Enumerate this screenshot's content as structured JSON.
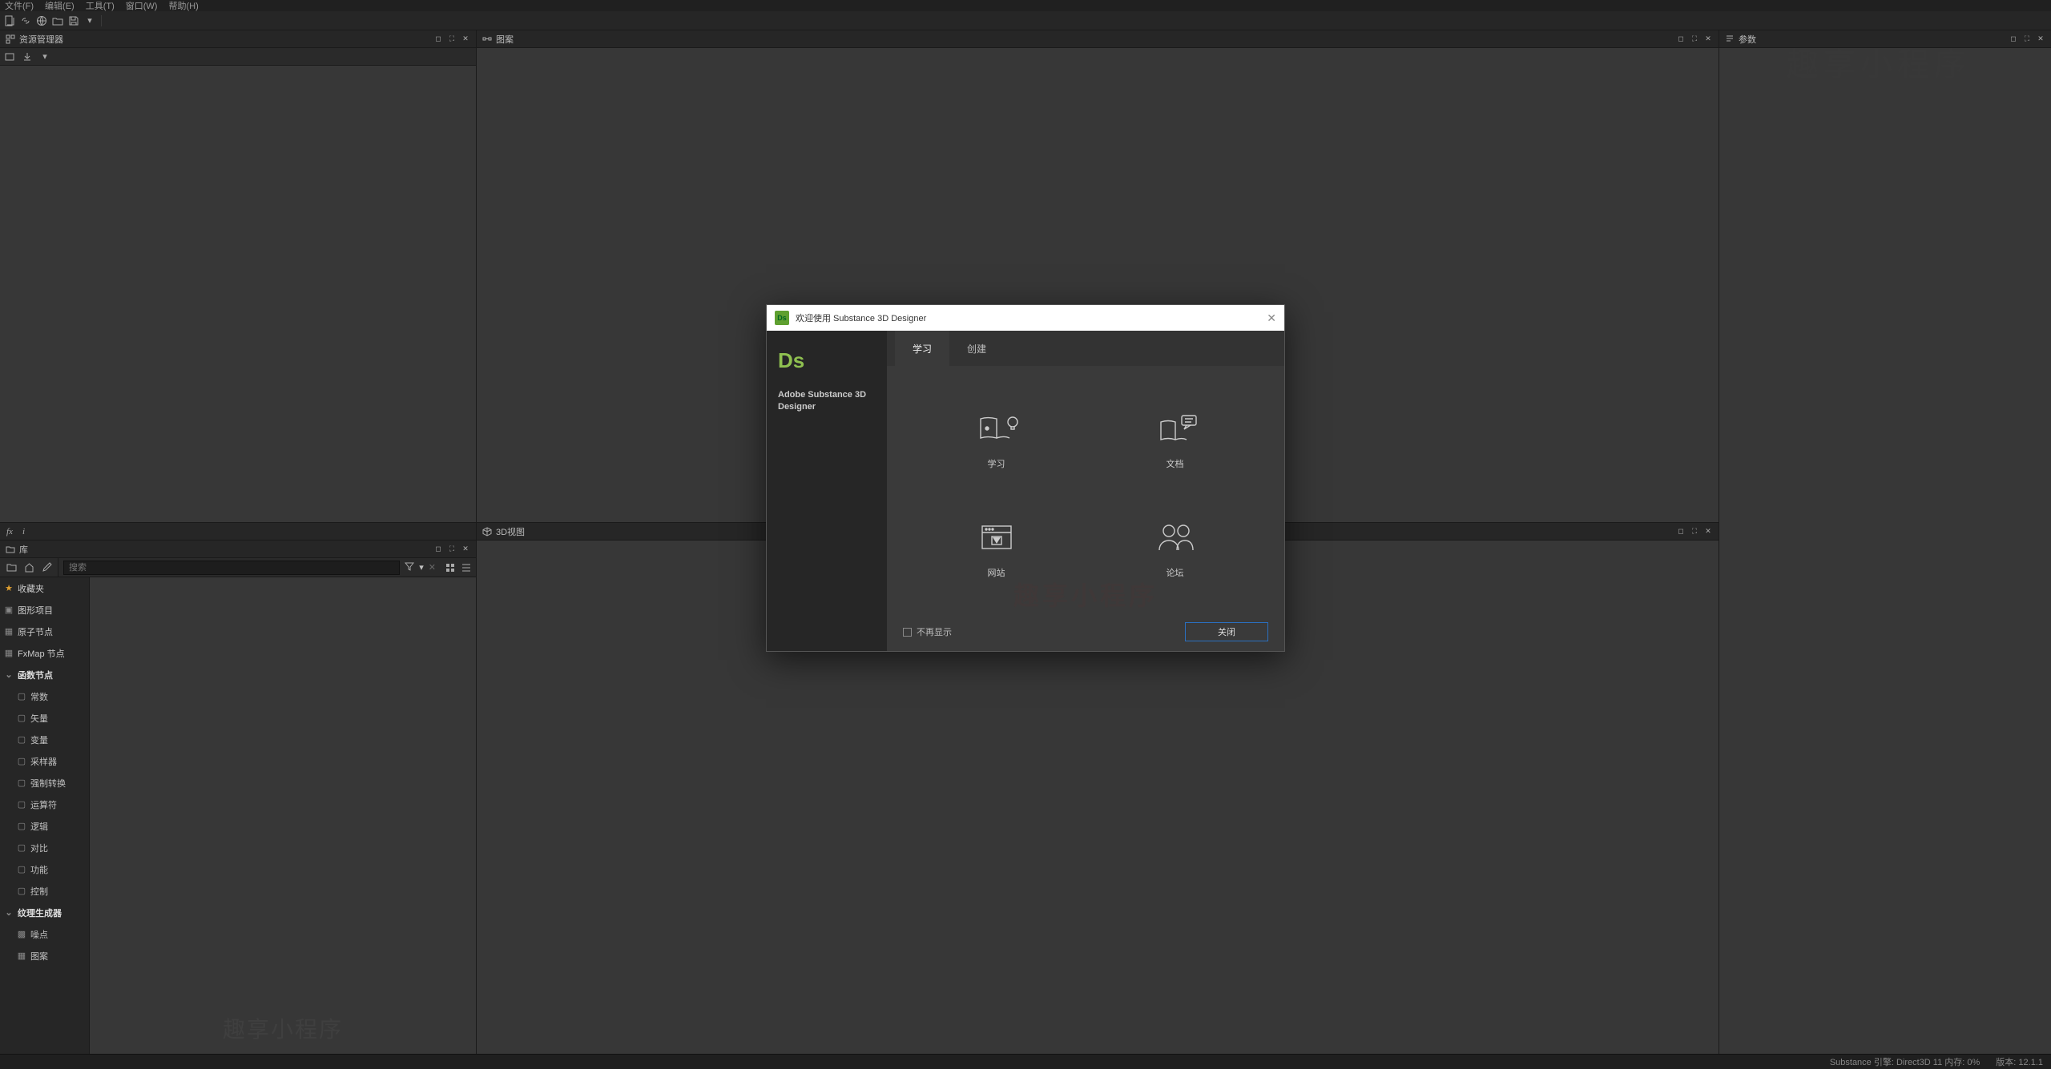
{
  "menu": {
    "file": "文件(F)",
    "edit": "编辑(E)",
    "tools": "工具(T)",
    "window": "窗口(W)",
    "help": "帮助(H)"
  },
  "panels": {
    "explorer": "资源管理器",
    "graph": "图案",
    "props": "参数",
    "library": "库",
    "view3d": "3D视图"
  },
  "search_placeholder": "搜索",
  "tree": {
    "favorites": "收藏夹",
    "graph_proj": "图形项目",
    "atomic": "原子节点",
    "fxmap": "FxMap 节点",
    "func": "函数节点",
    "func_items": [
      "常数",
      "矢量",
      "变量",
      "采样器",
      "强制转换",
      "运算符",
      "逻辑",
      "对比",
      "功能",
      "控制"
    ],
    "texgen": "纹理生成器",
    "texgen_items": [
      "噪点",
      "图案"
    ]
  },
  "dialog": {
    "title": "欢迎使用 Substance 3D Designer",
    "product_short": "Ds",
    "product": "Adobe Substance 3D Designer",
    "tab_learn": "学习",
    "tab_create": "创建",
    "card_learn": "学习",
    "card_docs": "文档",
    "card_site": "网站",
    "card_forum": "论坛",
    "dont_show": "不再显示",
    "close": "关闭"
  },
  "status": {
    "engine": "Substance 引擎: Direct3D 11 内存: 0%",
    "version": "版本: 12.1.1"
  },
  "watermark": "趣享小程序"
}
